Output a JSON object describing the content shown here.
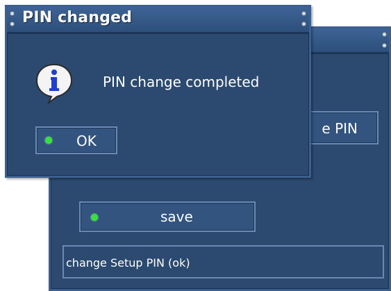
{
  "dialog": {
    "title": "PIN changed",
    "message": "PIN change completed",
    "ok_label": "OK",
    "icon": "info-icon"
  },
  "back_window": {
    "change_pin_label": "e PIN",
    "save_label": "save",
    "status_text": "change Setup PIN (ok)"
  },
  "colors": {
    "panel": "#2c4a6f",
    "border": "#6a8ab4",
    "led": "#37e03a",
    "text": "#ffffff"
  }
}
